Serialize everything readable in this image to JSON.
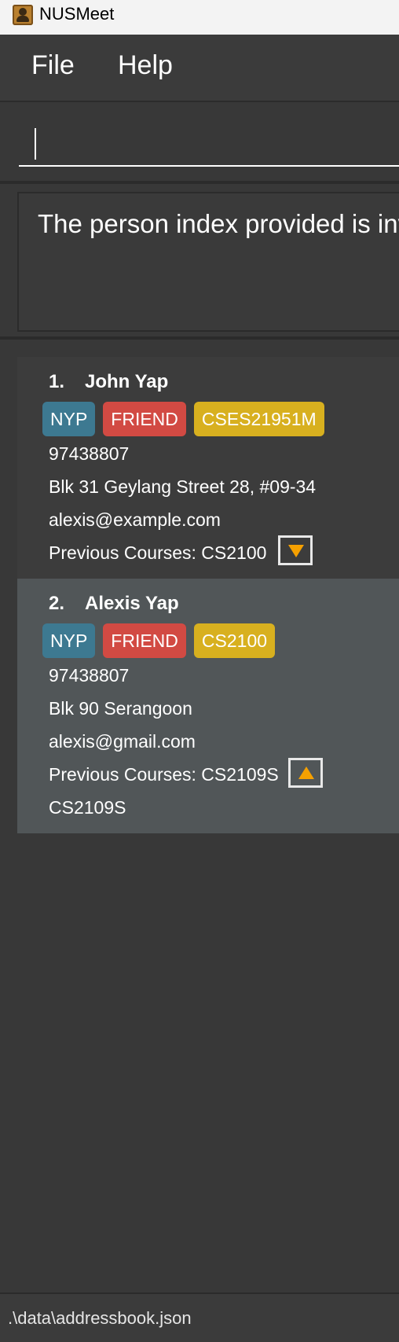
{
  "window": {
    "title": "NUSMeet"
  },
  "menu": {
    "items": [
      "File",
      "Help"
    ]
  },
  "command": {
    "value": ""
  },
  "result": {
    "text": "The person index provided is invalid"
  },
  "persons": [
    {
      "index": "1.",
      "name": "John Yap",
      "tags": [
        "NYP",
        "FRIEND",
        "CSES21951M"
      ],
      "phone": "97438807",
      "address": "Blk 31 Geylang Street 28, #09-34",
      "email": "alexis@example.com",
      "previous_courses_label": "Previous Courses: CS2100",
      "extra_course": "",
      "toggle_icon": "triangle-down-icon"
    },
    {
      "index": "2.",
      "name": "Alexis Yap",
      "tags": [
        "NYP",
        "FRIEND",
        "CS2100"
      ],
      "phone": "97438807",
      "address": "Blk 90 Serangoon",
      "email": "alexis@gmail.com",
      "previous_courses_label": "Previous Courses: CS2109S",
      "extra_course": "CS2109S",
      "toggle_icon": "triangle-up-icon"
    }
  ],
  "status": {
    "path": ".\\data\\addressbook.json"
  },
  "colors": {
    "tag_nyp": "#3d7991",
    "tag_friend": "#d24a43",
    "tag_course": "#d8b01f",
    "toggle_arrow": "#f5a000",
    "selected_card": "#515658"
  }
}
